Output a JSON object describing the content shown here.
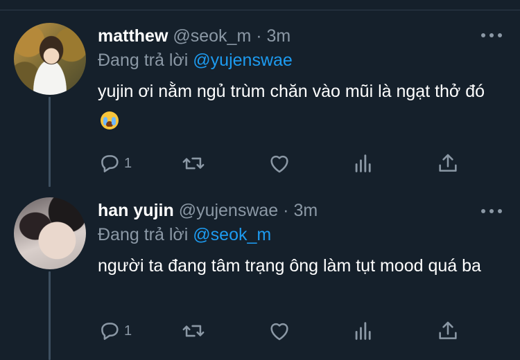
{
  "tweets": [
    {
      "name": "matthew",
      "handle": "@seok_m",
      "separator": "·",
      "time": "3m",
      "replying_prefix": "Đang trả lời",
      "replying_to": "@yujenswae",
      "text": "yujin ơi nằm ngủ trùm chăn vào mũi là ngạt thở đó",
      "emoji": "loudly-crying-face",
      "reply_count": "1",
      "avatar": "matthew-avatar"
    },
    {
      "name": "han yujin",
      "handle": "@yujenswae",
      "separator": "·",
      "time": "3m",
      "replying_prefix": "Đang trả lời",
      "replying_to": "@seok_m",
      "text": "người ta đang tâm trạng ông làm tụt mood quá ba",
      "reply_count": "1",
      "avatar": "yujin-avatar"
    }
  ],
  "icons": {
    "reply": "reply-icon",
    "retweet": "retweet-icon",
    "like": "heart-icon",
    "analytics": "analytics-icon",
    "share": "share-icon",
    "more": "more-icon"
  },
  "colors": {
    "background": "#15202b",
    "text": "#ffffff",
    "secondary": "#8b98a5",
    "accent": "#1d9bf0",
    "thread_line": "#3d4f60"
  }
}
